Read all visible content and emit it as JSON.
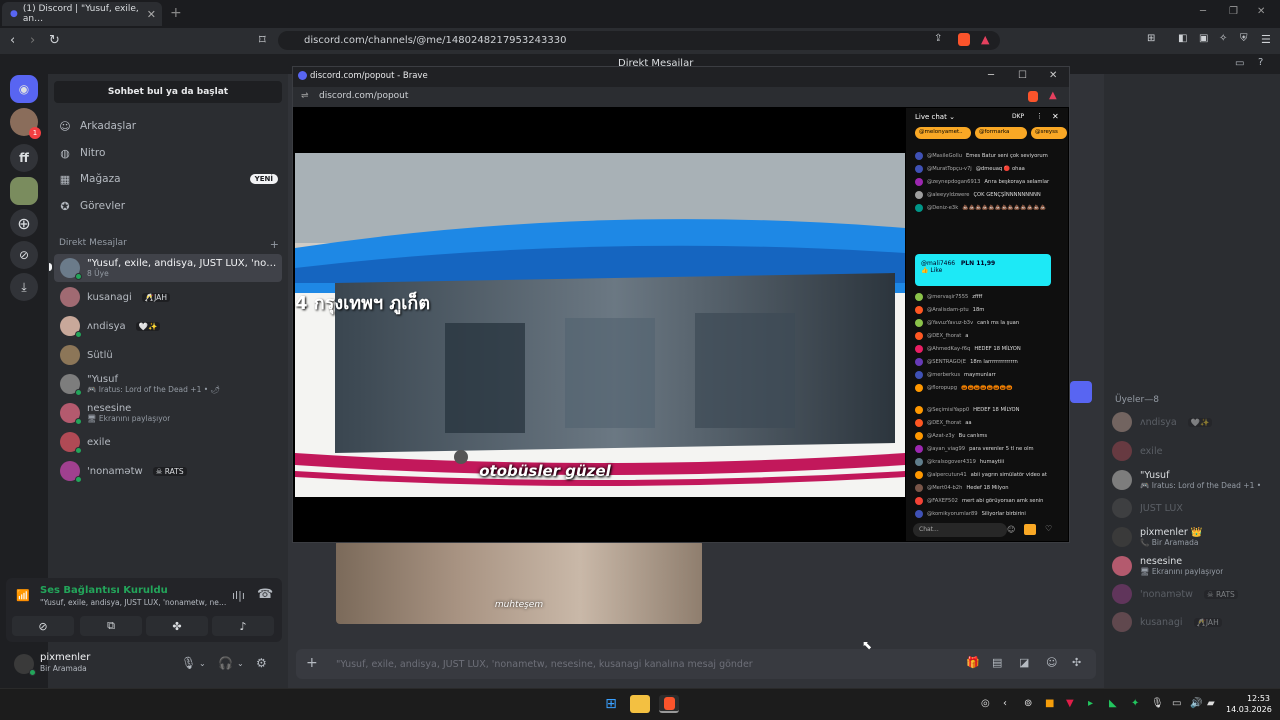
{
  "browser": {
    "tab_title": "(1) Discord | \"Yusuf, exile, an…",
    "url": "discord.com/channels/@me/1480248217953243330"
  },
  "discord_header": {
    "title": "Direkt Mesajlar"
  },
  "rail": {
    "items": [
      "discord-home",
      "group-avatar",
      "ff",
      "server-avatar",
      "add-server",
      "discover",
      "download"
    ],
    "ff_label": "ff",
    "unread_badge": "1"
  },
  "sidebar": {
    "find_conversation": "Sohbet bul ya da başlat",
    "nav": [
      {
        "label": "Arkadaşlar",
        "icon": "friends-icon"
      },
      {
        "label": "Nitro",
        "icon": "nitro-icon"
      },
      {
        "label": "Mağaza",
        "icon": "shop-icon",
        "badge": "YENİ"
      },
      {
        "label": "Görevler",
        "icon": "quests-icon"
      }
    ],
    "dm_header": "Direkt Mesajlar",
    "dm_add": "+",
    "dms": [
      {
        "name": "\"Yusuf, exile, andisya, JUST LUX, 'nona...",
        "sub": "8 Üye",
        "tag": ""
      },
      {
        "name": "kusanagi",
        "sub": "",
        "tag": "🥂JAH"
      },
      {
        "name": "ᴧndisya",
        "sub": "",
        "tag": "🤍✨"
      },
      {
        "name": "Sütlü",
        "sub": "",
        "tag": ""
      },
      {
        "name": "\"Yusuf",
        "sub": "🎮 Iratus: Lord of the Dead +1 • 🌶",
        "tag": ""
      },
      {
        "name": "nesesine",
        "sub": "🖥 Ekranını paylaşıyor",
        "tag": ""
      },
      {
        "name": "exile",
        "sub": "",
        "tag": ""
      },
      {
        "name": "'nonamǝtw",
        "sub": "",
        "tag": "☠ RATS"
      }
    ]
  },
  "voice": {
    "status": "Ses Bağlantısı Kuruldu",
    "channel": "\"Yusuf, exile, andisya, JUST LUX, 'nonametw, nese..."
  },
  "user": {
    "name": "pixmenler",
    "status": "Bir Aramada"
  },
  "popout": {
    "title": "discord.com/popout - Brave",
    "url": "discord.com/popout",
    "caption": "otobüsler güzel",
    "bus_text": "4 กรุงเทพฯ ภูเก็ต"
  },
  "livechat": {
    "title": "Live chat ⌄",
    "dkp": "DKP",
    "pills": [
      "@melonyamet..",
      "@formarka",
      "@sreyss"
    ],
    "messages": [
      {
        "user": "@MasileGollu",
        "text": "Emes Batur seni çok seviyorum",
        "color": "#3f51b5"
      },
      {
        "user": "@MuratTopçu-v7j",
        "text": "@dmeuaq 🔴 ohaa",
        "color": "#3f51b5"
      },
      {
        "user": "@zeynepdogan6913",
        "text": "Arıra beşkoraya selamlar",
        "color": "#9c27b0"
      },
      {
        "user": "@aleeyyldzwere",
        "text": "ÇOK GENÇŞİNNNNNNNNN",
        "color": "#9e9e9e"
      },
      {
        "user": "@Deniz-e3k",
        "text": "💩💩💩💩💩💩💩💩💩💩💩💩💩",
        "color": "#009688"
      },
      {
        "user": "@mervaşir7555",
        "text": "zffff",
        "color": "#8bc34a"
      },
      {
        "user": "@Aralisdam-ptu",
        "text": "18m",
        "color": "#ff5722"
      },
      {
        "user": "@YavuzYavuz-b3v",
        "text": "canlı ms la şuan",
        "color": "#8bc34a"
      },
      {
        "user": "@DEX_fhorat",
        "text": "a",
        "color": "#ff5722"
      },
      {
        "user": "@AhmedKay-f6q",
        "text": "HEDEF 18 MİLYON",
        "color": "#e91e63"
      },
      {
        "user": "@SENTRAGO(E",
        "text": "18m larrrrrrrrrrrrrn",
        "color": "#673ab7"
      },
      {
        "user": "@merberkus",
        "text": "maymunlarr",
        "color": "#3f51b5"
      },
      {
        "user": "@floropupg",
        "text": "🎃🎃🎃🎃🎃🎃🎃🎃",
        "color": "#ff9800"
      },
      {
        "user": "@SeçimisiYapp0",
        "text": "HEDEF 18 MİLYON",
        "color": "#ff9800"
      },
      {
        "user": "@DEX_fhorat",
        "text": "aa",
        "color": "#ff5722"
      },
      {
        "user": "@Azat-z3y",
        "text": "Bu canlıms",
        "color": "#ff9800"
      },
      {
        "user": "@ayan_viag99",
        "text": "para verenler 5 tl ne olm",
        "color": "#9c27b0"
      },
      {
        "user": "@kralsogover4319",
        "text": "humaytiii",
        "color": "#607d8b"
      },
      {
        "user": "@alpercutun41",
        "text": "abii yagrın simülatör video at",
        "color": "#ff9800"
      },
      {
        "user": "@Mert04-b2h",
        "text": "Hedef 18 Milyon",
        "color": "#795548"
      },
      {
        "user": "@FAXEF502",
        "text": "mert abi görüyorsan amk senin",
        "color": "#f44336"
      },
      {
        "user": "@komikyorumlar89",
        "text": "Siliyorlar birbirini",
        "color": "#3f51b5"
      }
    ],
    "superchat_user": "@mali7466",
    "superchat_amount": "PLN 11,99",
    "superchat_like": "👍 Like",
    "input_placeholder": "Chat..."
  },
  "chat": {
    "thumb_caption": "muhteşem",
    "input_placeholder": "\"Yusuf, exile, andisya, JUST LUX, 'nonametw, nesesine, kusanagi kanalına mesaj gönder"
  },
  "members": {
    "header": "Üyeler—8",
    "list": [
      {
        "name": "ᴧndisya",
        "sub": "",
        "tag": "🤍✨",
        "dim": true
      },
      {
        "name": "exile",
        "sub": "",
        "tag": "",
        "dim": true
      },
      {
        "name": "\"Yusuf",
        "sub": "🎮 Iratus: Lord of the Dead +1 •",
        "tag": "",
        "dim": false
      },
      {
        "name": "JUST LUX",
        "sub": "",
        "tag": "",
        "dim": true
      },
      {
        "name": "pixmenler 👑",
        "sub": "📞 Bir Aramada",
        "tag": "",
        "dim": false
      },
      {
        "name": "nesesine",
        "sub": "🖥 Ekranını paylaşıyor",
        "tag": "",
        "dim": false
      },
      {
        "name": "'nonamǝtw",
        "sub": "",
        "tag": "☠ RATS",
        "dim": true
      },
      {
        "name": "kusanagi",
        "sub": "",
        "tag": "🥂JAH",
        "dim": true
      }
    ]
  },
  "taskbar": {
    "time": "12:53",
    "date": "14.03.2026"
  }
}
